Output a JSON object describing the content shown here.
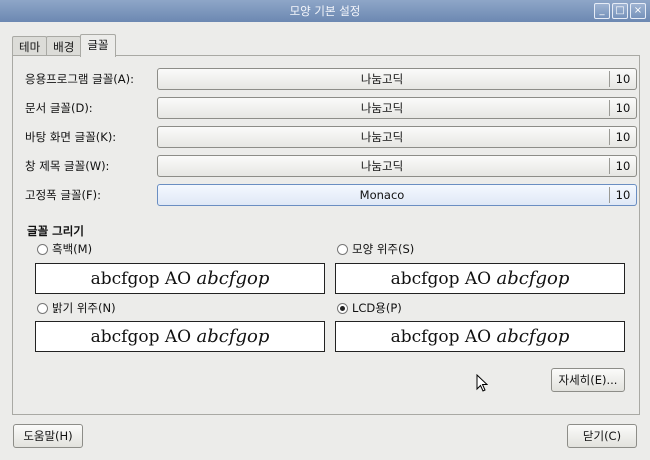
{
  "window": {
    "title": "모양 기본 설정",
    "controls": [
      "_",
      "□",
      "×"
    ]
  },
  "tabs": [
    {
      "label": "테마"
    },
    {
      "label": "배경"
    },
    {
      "label": "글꼴"
    }
  ],
  "fonts": [
    {
      "label": "응용프로그램 글꼴(A):",
      "name": "나눔고딕",
      "size": "10"
    },
    {
      "label": "문서 글꼴(D):",
      "name": "나눔고딕",
      "size": "10"
    },
    {
      "label": "바탕 화면 글꼴(K):",
      "name": "나눔고딕",
      "size": "10"
    },
    {
      "label": "창 제목 글꼴(W):",
      "name": "나눔고딕",
      "size": "10"
    },
    {
      "label": "고정폭 글꼴(F):",
      "name": "Monaco",
      "size": "10"
    }
  ],
  "rendering": {
    "title": "글꼴 그리기",
    "options": [
      {
        "label": "흑백(M)",
        "checked": false,
        "preview_plain": "abcfgop AO ",
        "preview_italic": "abcfgop"
      },
      {
        "label": "모양 위주(S)",
        "checked": false,
        "preview_plain": "abcfgop AO ",
        "preview_italic": "abcfgop"
      },
      {
        "label": "밝기 위주(N)",
        "checked": false,
        "preview_plain": "abcfgop AO ",
        "preview_italic": "abcfgop"
      },
      {
        "label": "LCD용(P)",
        "checked": true,
        "preview_plain": "abcfgop AO ",
        "preview_italic": "abcfgop"
      }
    ]
  },
  "buttons": {
    "details": "자세히(E)...",
    "help": "도움말(H)",
    "close": "닫기(C)"
  }
}
